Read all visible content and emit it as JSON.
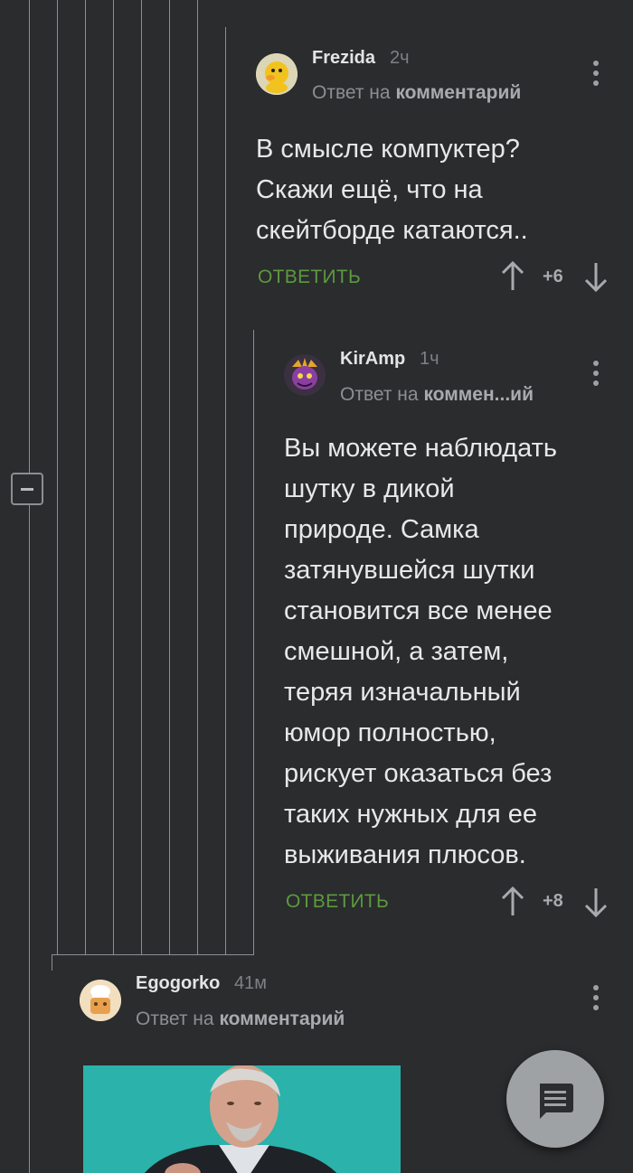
{
  "comments": [
    {
      "author": "Frezida",
      "time": "2ч",
      "reply_prefix": "Ответ на",
      "reply_target": "комментарий",
      "text_lines": [
        "В смысле компуктер?",
        "Скажи ещё, что на",
        "скейтборде катаются.."
      ],
      "reply_label": "ОТВЕТИТЬ",
      "rating": "+6"
    },
    {
      "author": "KirAmp",
      "time": "1ч",
      "reply_prefix": "Ответ на",
      "reply_target": "коммен...ий",
      "text_lines": [
        "Вы можете наблюдать",
        "шутку в дикой",
        "природе. Самка",
        "затянувшейся шутки",
        "становится все менее",
        "смешной, а затем,",
        "теряя изначальный",
        "юмор полностью,",
        "рискует оказаться без",
        "таких нужных для ее",
        "выживания плюсов."
      ],
      "reply_label": "ОТВЕТИТЬ",
      "rating": "+8"
    },
    {
      "author": "Egogorko",
      "time": "41м",
      "reply_prefix": "Ответ на",
      "reply_target": "комментарий"
    }
  ],
  "icons": {
    "upvote": "arrow-up-icon",
    "downvote": "arrow-down-icon",
    "more": "more-vertical-icon",
    "collapse": "minus-icon",
    "fab": "comment-icon"
  },
  "colors": {
    "background": "#2a2c2e",
    "reply_green": "#5c9a3e",
    "thread_line": "#8c8f92"
  }
}
